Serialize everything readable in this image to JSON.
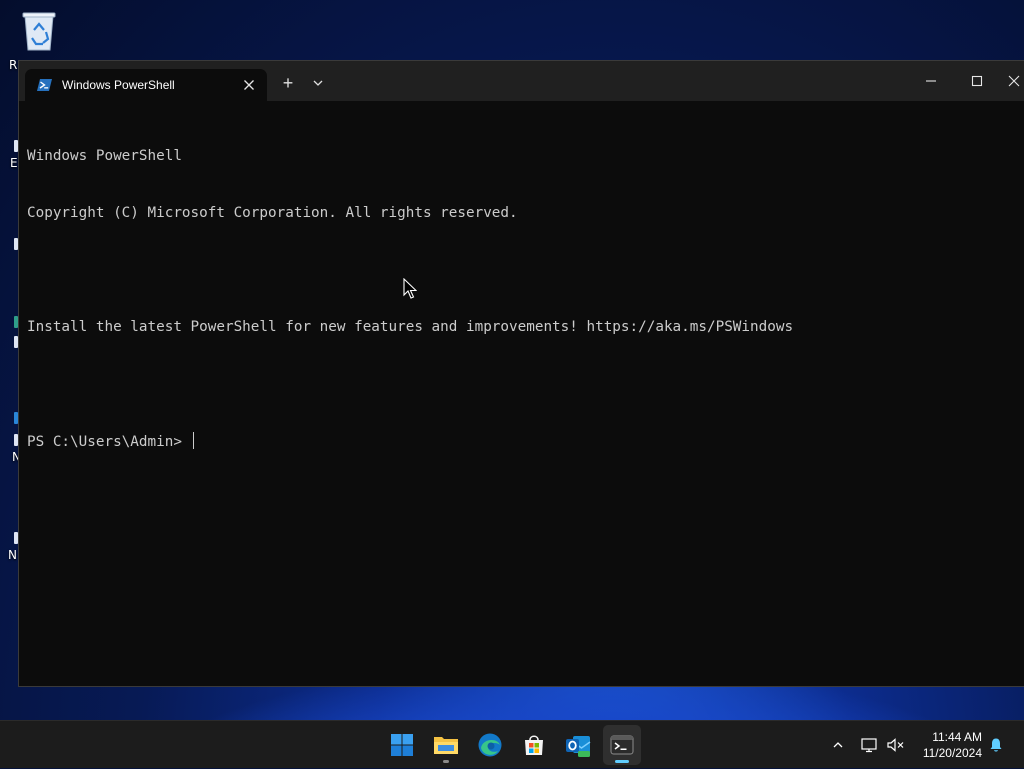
{
  "desktop": {
    "icon_labels": [
      "R",
      "E",
      "N",
      "N"
    ]
  },
  "window": {
    "tab_title": "Windows PowerShell",
    "new_tab_symbol": "+",
    "console_lines": [
      "Windows PowerShell",
      "Copyright (C) Microsoft Corporation. All rights reserved.",
      "",
      "Install the latest PowerShell for new features and improvements! https://aka.ms/PSWindows",
      ""
    ],
    "prompt": "PS C:\\Users\\Admin> "
  },
  "taskbar": {
    "apps": [
      "start",
      "file-explorer",
      "edge",
      "microsoft-store",
      "outlook-new",
      "terminal"
    ],
    "active_app": "terminal",
    "clock_time": "11:44 AM",
    "clock_date": "11/20/2024"
  },
  "colors": {
    "console_bg": "#0c0c0c",
    "console_text": "#cccccc",
    "titlebar_bg": "#202020",
    "taskbar_bg": "#1c1c1c",
    "accent": "#60cdff"
  }
}
